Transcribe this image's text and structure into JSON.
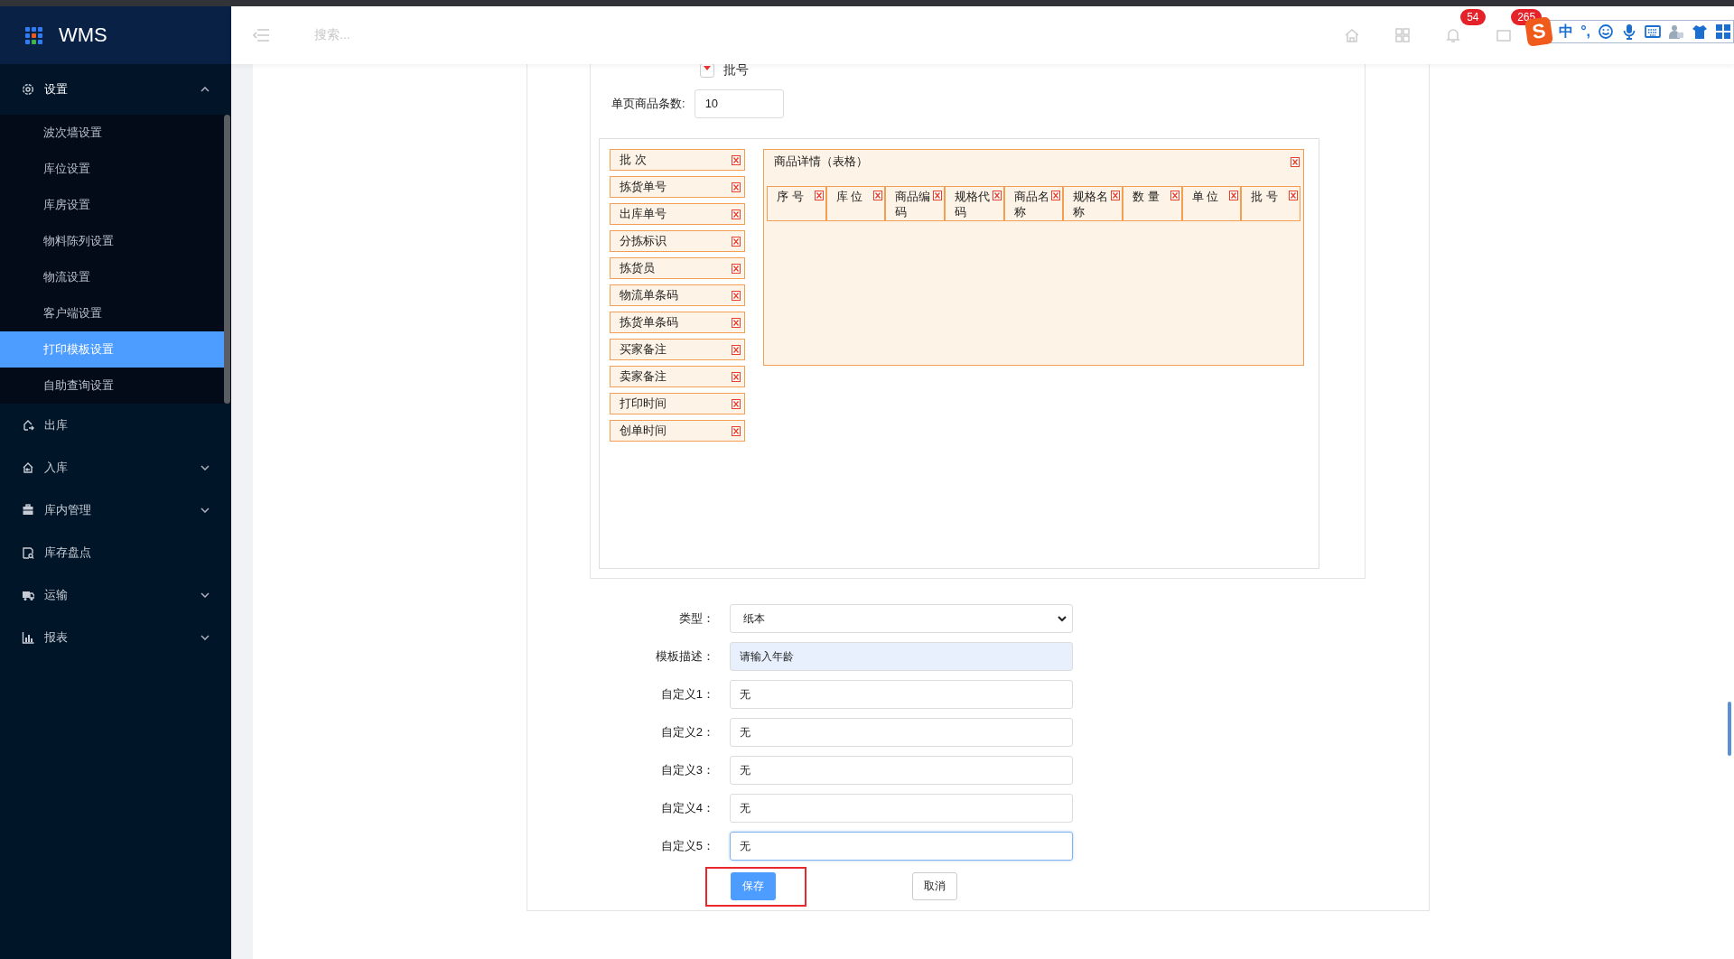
{
  "sidebar": {
    "brand": "WMS",
    "menu": [
      {
        "label": "设置",
        "kind": "group",
        "expanded": true,
        "children": [
          {
            "label": "波次墙设置",
            "selected": false
          },
          {
            "label": "库位设置",
            "selected": false
          },
          {
            "label": "库房设置",
            "selected": false
          },
          {
            "label": "物料陈列设置",
            "selected": false
          },
          {
            "label": "物流设置",
            "selected": false
          },
          {
            "label": "客户端设置",
            "selected": false
          },
          {
            "label": "打印模板设置",
            "selected": true
          },
          {
            "label": "自助查询设置",
            "selected": false
          }
        ]
      },
      {
        "label": "出库",
        "kind": "link"
      },
      {
        "label": "入库",
        "kind": "group",
        "expanded": false
      },
      {
        "label": "库内管理",
        "kind": "group",
        "expanded": false
      },
      {
        "label": "库存盘点",
        "kind": "link"
      },
      {
        "label": "运输",
        "kind": "group",
        "expanded": false
      },
      {
        "label": "报表",
        "kind": "group",
        "expanded": false
      }
    ]
  },
  "header": {
    "search_placeholder": "搜索...",
    "badges": [
      "54",
      "265"
    ]
  },
  "ime_toolbar": {
    "logo": "S",
    "texts": [
      "中",
      "°,"
    ]
  },
  "template": {
    "option": {
      "label": "批号",
      "checked": true
    },
    "page_size": {
      "label": "单页商品条数:",
      "value": "10"
    },
    "fields": [
      "批 次",
      "拣货单号",
      "出库单号",
      "分拣标识",
      "拣货员",
      "物流单条码",
      "拣货单条码",
      "买家备注",
      "卖家备注",
      "打印时间",
      "创单时间"
    ],
    "table": {
      "title": "商品详情（表格）",
      "columns": [
        "序 号",
        "库 位",
        "商品编码",
        "规格代码",
        "商品名称",
        "规格名称",
        "数 量",
        "单 位",
        "批 号"
      ]
    }
  },
  "form": {
    "rows": [
      {
        "label": "类型：",
        "kind": "select",
        "value": "纸本",
        "autofilled": false,
        "focused": false
      },
      {
        "label": "模板描述：",
        "kind": "input",
        "value": "请输入年龄",
        "autofilled": true,
        "focused": false
      },
      {
        "label": "自定义1：",
        "kind": "input",
        "value": "无",
        "autofilled": false,
        "focused": false
      },
      {
        "label": "自定义2：",
        "kind": "input",
        "value": "无",
        "autofilled": false,
        "focused": false
      },
      {
        "label": "自定义3：",
        "kind": "input",
        "value": "无",
        "autofilled": false,
        "focused": false
      },
      {
        "label": "自定义4：",
        "kind": "input",
        "value": "无",
        "autofilled": false,
        "focused": false
      },
      {
        "label": "自定义5：",
        "kind": "input",
        "value": "无",
        "autofilled": false,
        "focused": true
      }
    ],
    "buttons": [
      {
        "label": "保存",
        "kind": "primary",
        "highlighted": true
      },
      {
        "label": "取消",
        "kind": "default",
        "highlighted": false
      }
    ]
  }
}
